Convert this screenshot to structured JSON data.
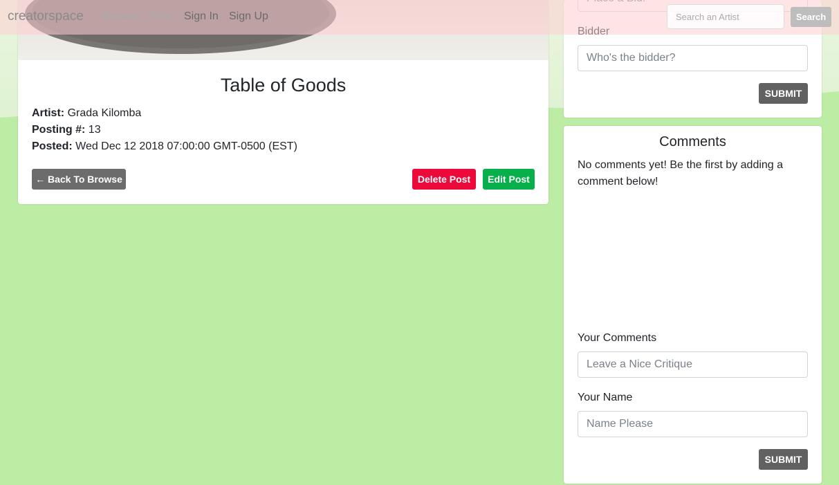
{
  "nav": {
    "brand": "creatorspace",
    "links": [
      "Browse",
      "Post",
      "Sign In",
      "Sign Up"
    ],
    "search_placeholder": "Search an Artist",
    "search_button": "Search"
  },
  "post": {
    "title": "Table of Goods",
    "artist_label": "Artist:",
    "artist": "Grada Kilomba",
    "posting_label": "Posting #:",
    "posting_number": "13",
    "posted_label": "Posted:",
    "posted": "Wed Dec 12 2018 07:00:00 GMT-0500 (EST)",
    "back_button": "← Back To Browse",
    "delete_button": "Delete Post",
    "edit_button": "Edit Post"
  },
  "bid": {
    "bid_placeholder": "Place a Bid!",
    "bidder_label": "Bidder",
    "bidder_placeholder": "Who's the bidder?",
    "submit": "SUBMIT"
  },
  "comments": {
    "title": "Comments",
    "empty_message": "No comments yet! Be the first by adding a comment below!",
    "your_comments_label": "Your Comments",
    "comments_placeholder": "Leave a Nice Critique",
    "your_name_label": "Your Name",
    "name_placeholder": "Name Please",
    "submit": "SUBMIT"
  },
  "colors": {
    "page_background": "#bdeca5",
    "delete": "#ec0a3b",
    "edit": "#08b04c",
    "dark_button": "#616161"
  }
}
